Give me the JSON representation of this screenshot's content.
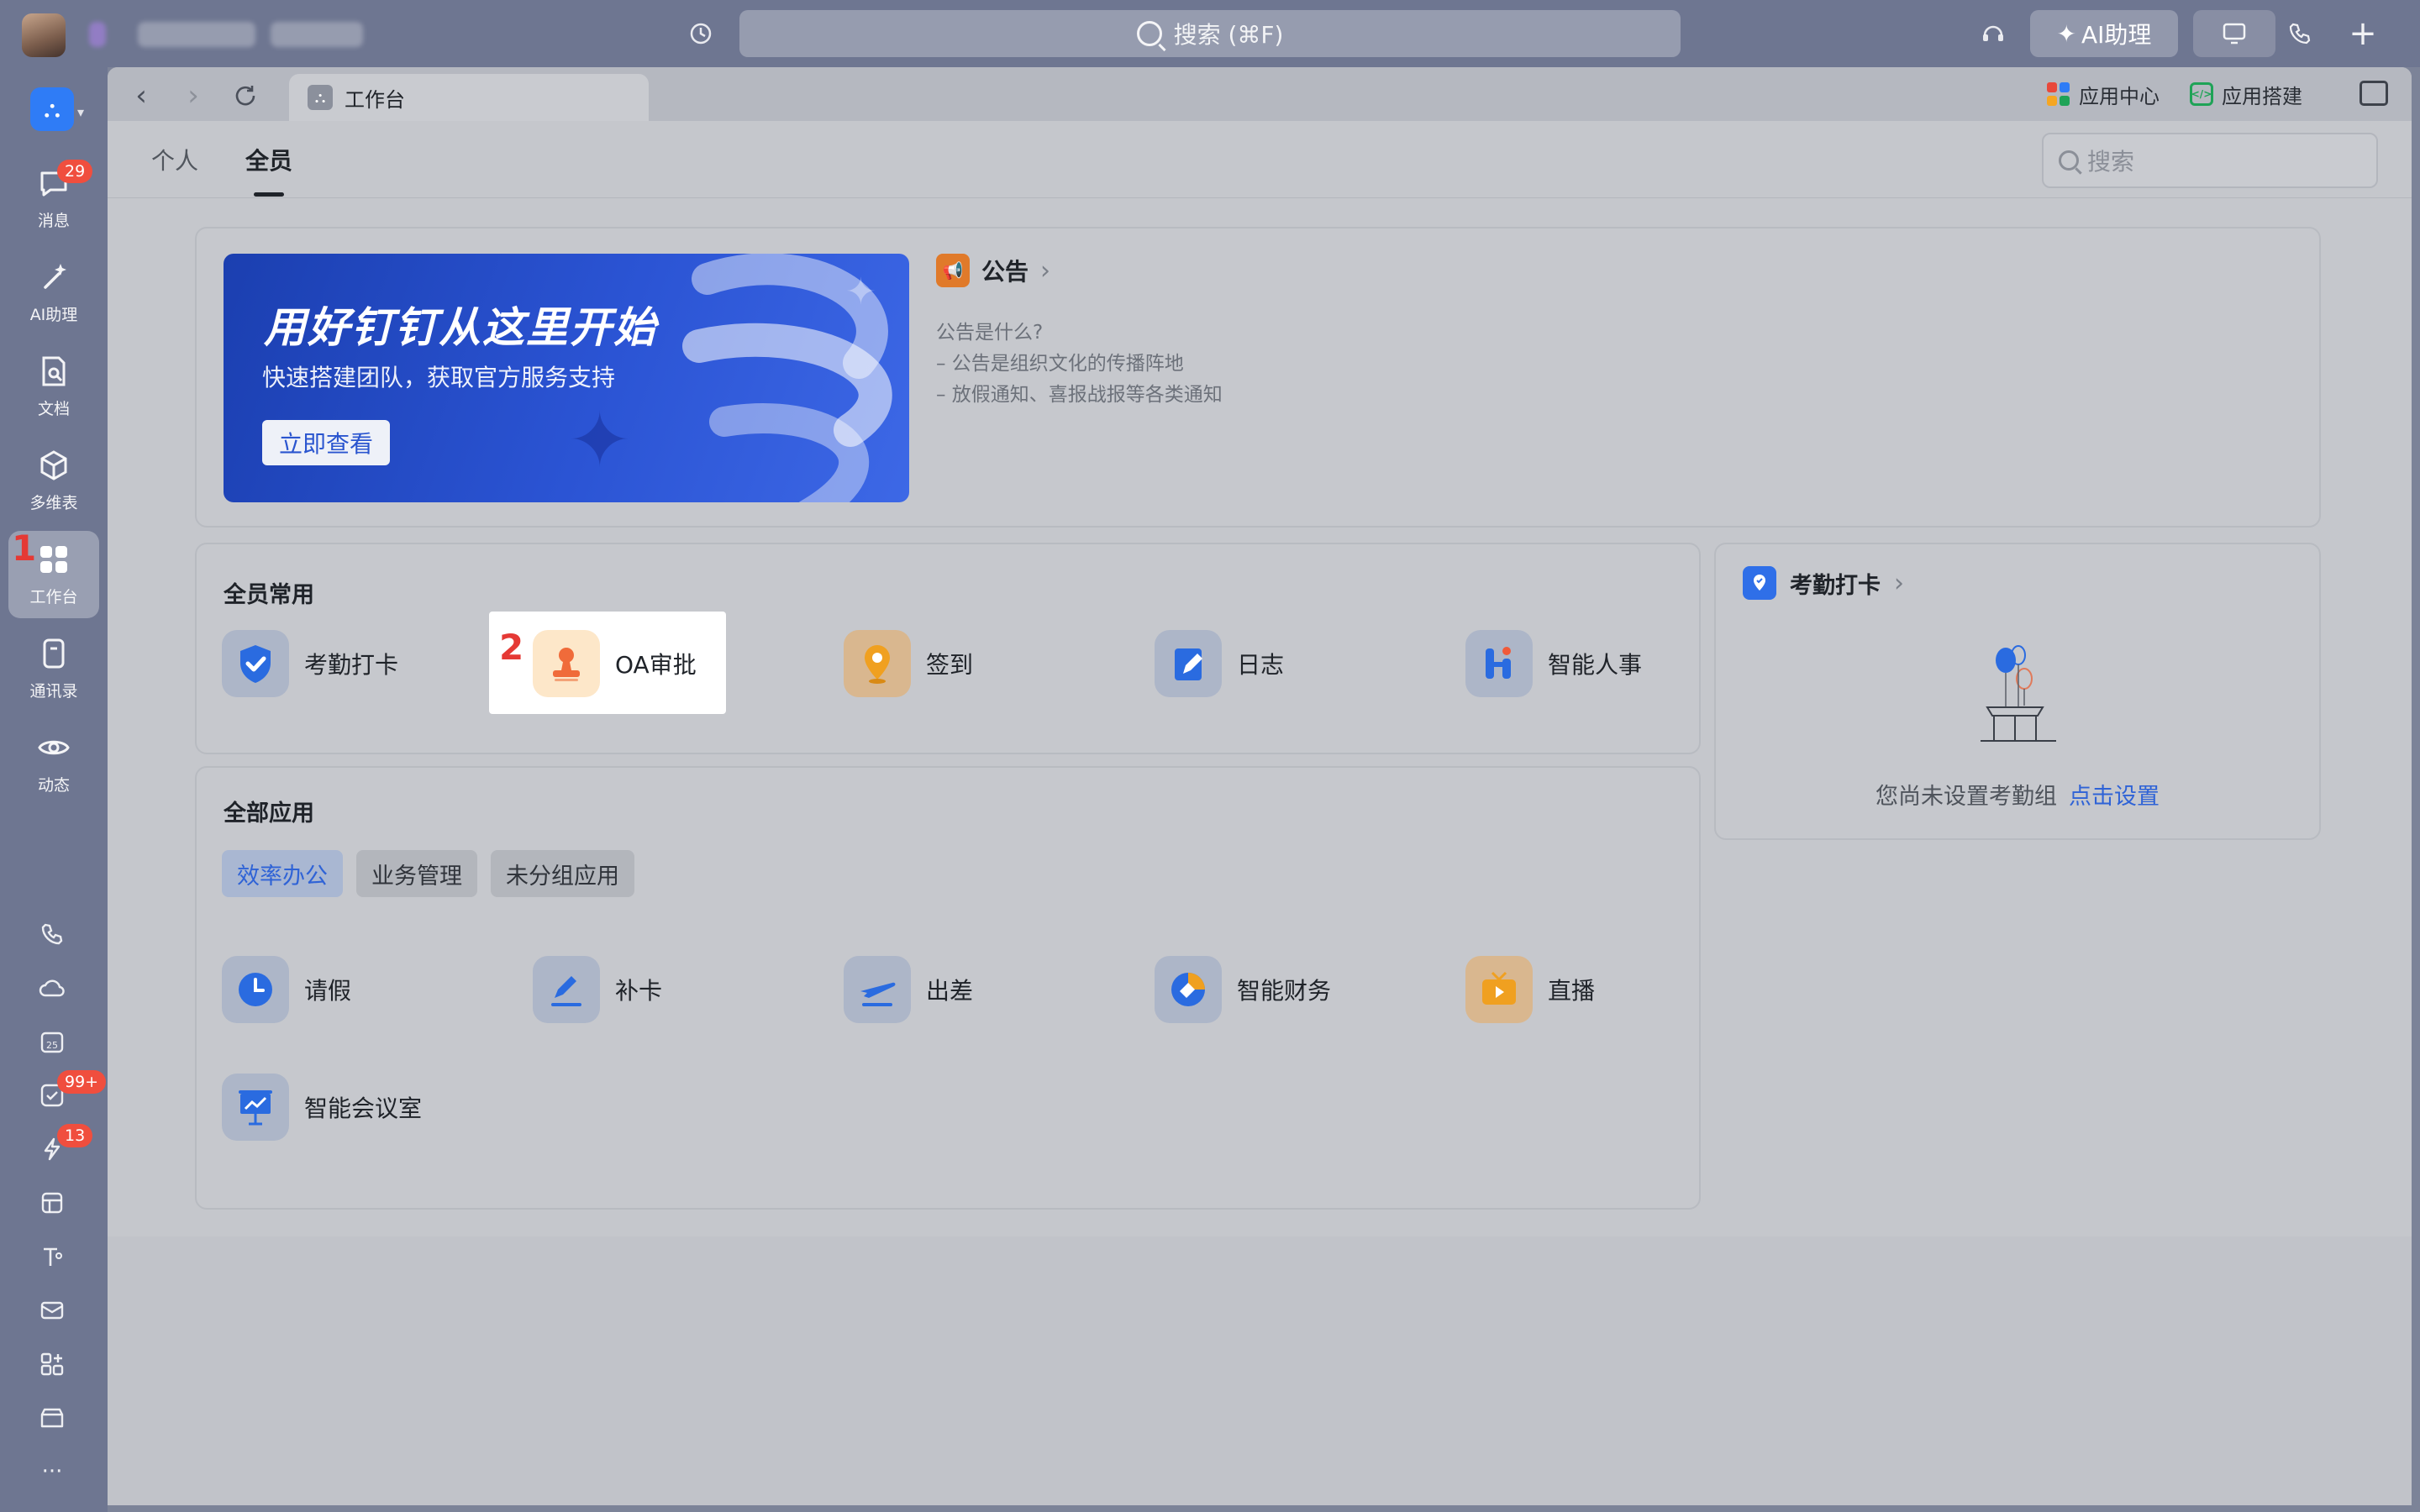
{
  "titlebar": {
    "search_placeholder": "搜索 (⌘F)",
    "ai_button": "AI助理"
  },
  "sidebar": {
    "items": [
      {
        "label": "消息",
        "badge": "29",
        "icon": "message-icon"
      },
      {
        "label": "AI助理",
        "icon": "sparkle-pen-icon"
      },
      {
        "label": "文档",
        "icon": "doc-search-icon"
      },
      {
        "label": "多维表",
        "icon": "cube-icon"
      },
      {
        "label": "工作台",
        "icon": "apps-grid-icon",
        "active": true
      },
      {
        "label": "通讯录",
        "icon": "contacts-icon"
      },
      {
        "label": "动态",
        "icon": "eye-icon"
      }
    ],
    "mini": [
      {
        "icon": "phone-icon"
      },
      {
        "icon": "cloud-icon"
      },
      {
        "icon": "calendar-icon",
        "text": "25"
      },
      {
        "icon": "todo-check-icon",
        "badge": "99+"
      },
      {
        "icon": "lightning-icon",
        "badge": "13"
      },
      {
        "icon": "box-icon"
      },
      {
        "icon": "text-tool-icon"
      },
      {
        "icon": "mail-icon"
      },
      {
        "icon": "add-apps-icon"
      },
      {
        "icon": "archive-icon"
      },
      {
        "icon": "more-icon",
        "text": "···"
      }
    ]
  },
  "annotations": {
    "mark1": "1",
    "mark2": "2"
  },
  "tabbar": {
    "tab_title": "工作台",
    "app_center": "应用中心",
    "app_build": "应用搭建"
  },
  "workspace": {
    "view_tabs": [
      {
        "label": "个人"
      },
      {
        "label": "全员"
      }
    ],
    "search_placeholder": "搜索",
    "banner": {
      "title": "用好钉钉从这里开始",
      "subtitle": "快速搭建团队，获取官方服务支持",
      "button": "立即查看"
    },
    "notice": {
      "title": "公告",
      "lines": [
        "公告是什么?",
        "– 公告是组织文化的传播阵地",
        "– 放假通知、喜报战报等各类通知"
      ]
    },
    "common": {
      "title": "全员常用",
      "apps": [
        {
          "label": "考勤打卡",
          "icon": "check-shield-icon"
        },
        {
          "label": "OA审批",
          "icon": "stamp-icon"
        },
        {
          "label": "签到",
          "icon": "location-pin-icon"
        },
        {
          "label": "日志",
          "icon": "note-pen-icon"
        },
        {
          "label": "智能人事",
          "icon": "hr-person-icon"
        }
      ]
    },
    "all_apps": {
      "title": "全部应用",
      "chips": [
        {
          "label": "效率办公",
          "active": true
        },
        {
          "label": "业务管理"
        },
        {
          "label": "未分组应用"
        }
      ],
      "apps": [
        {
          "label": "请假",
          "icon": "clock-icon"
        },
        {
          "label": "补卡",
          "icon": "pen-line-icon"
        },
        {
          "label": "出差",
          "icon": "plane-icon"
        },
        {
          "label": "智能财务",
          "icon": "finance-icon"
        },
        {
          "label": "直播",
          "icon": "tv-play-icon"
        },
        {
          "label": "智能会议室",
          "icon": "presentation-icon"
        }
      ]
    },
    "attendance": {
      "title": "考勤打卡",
      "empty_text": "您尚未设置考勤组",
      "setup_link": "点击设置"
    }
  },
  "colors": {
    "accent": "#2f63d6",
    "badge": "#f04e3e",
    "banner": "#2b54d4"
  }
}
